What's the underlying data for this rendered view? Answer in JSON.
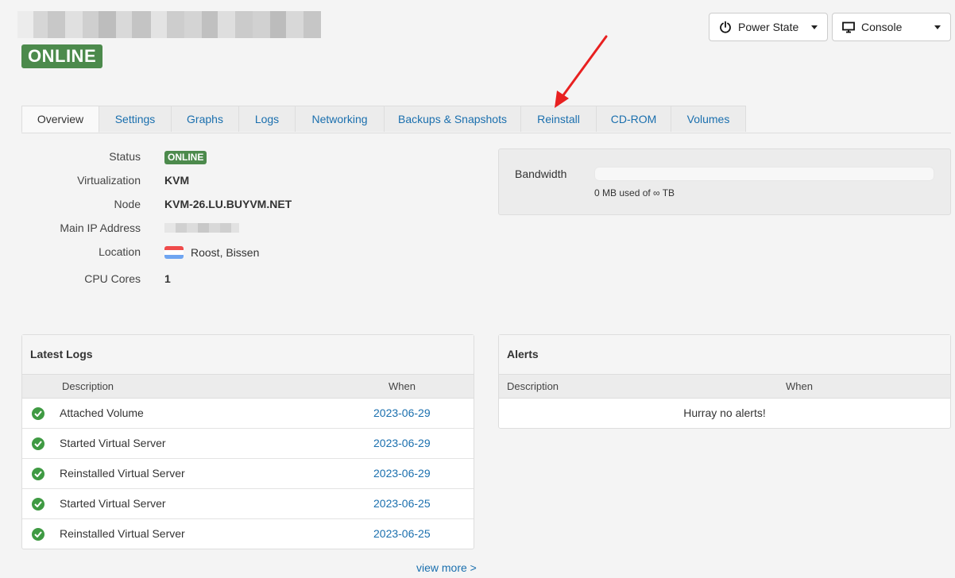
{
  "status_header": {
    "state": "ONLINE"
  },
  "toolbar": {
    "power_label": "Power State",
    "console_label": "Console"
  },
  "tabs": [
    {
      "label": "Overview",
      "active": true
    },
    {
      "label": "Settings"
    },
    {
      "label": "Graphs"
    },
    {
      "label": "Logs"
    },
    {
      "label": "Networking"
    },
    {
      "label": "Backups & Snapshots"
    },
    {
      "label": "Reinstall"
    },
    {
      "label": "CD-ROM"
    },
    {
      "label": "Volumes"
    }
  ],
  "info": {
    "status_label": "Status",
    "status_value": "ONLINE",
    "virt_label": "Virtualization",
    "virt_value": "KVM",
    "node_label": "Node",
    "node_value": "KVM-26.LU.BUYVM.NET",
    "ip_label": "Main IP Address",
    "location_label": "Location",
    "location_value": "Roost, Bissen",
    "cpu_label": "CPU Cores",
    "cpu_value": "1"
  },
  "bandwidth": {
    "label": "Bandwidth",
    "usage_text": "0 MB used of ∞ TB",
    "used_fraction": 0
  },
  "logs": {
    "title": "Latest Logs",
    "col_description": "Description",
    "col_when": "When",
    "rows": [
      {
        "description": "Attached Volume",
        "when": "2023-06-29"
      },
      {
        "description": "Started Virtual Server",
        "when": "2023-06-29"
      },
      {
        "description": "Reinstalled Virtual Server",
        "when": "2023-06-29"
      },
      {
        "description": "Started Virtual Server",
        "when": "2023-06-25"
      },
      {
        "description": "Reinstalled Virtual Server",
        "when": "2023-06-25"
      }
    ],
    "view_more": "view more >"
  },
  "alerts": {
    "title": "Alerts",
    "col_description": "Description",
    "col_when": "When",
    "empty_text": "Hurray no alerts!"
  },
  "colors": {
    "success": "#4c8a4c",
    "link": "#1a6fae",
    "annotation_arrow": "#e82020"
  }
}
